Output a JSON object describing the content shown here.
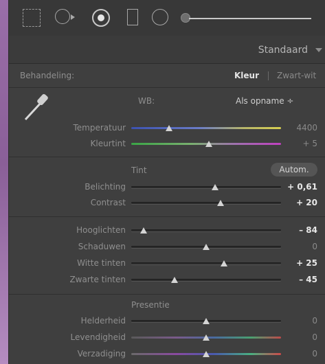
{
  "toolbar": {
    "tools": [
      "crop-overlay-icon",
      "spot-removal-icon",
      "red-eye-icon",
      "graduated-filter-icon",
      "radial-filter-icon",
      "adjustment-brush-icon"
    ]
  },
  "preset": {
    "label": "Standaard"
  },
  "treatment": {
    "label": "Behandeling:",
    "color": "Kleur",
    "bw": "Zwart-wit"
  },
  "wb": {
    "label": "WB:",
    "value": "Als opname ÷",
    "sliders": [
      {
        "label": "Temperatuur",
        "value": "4400",
        "pos": 0.25
      },
      {
        "label": "Kleurtint",
        "value": "+ 5",
        "pos": 0.52
      }
    ]
  },
  "tone": {
    "title": "Tint",
    "auto": "Autom.",
    "sliders": [
      {
        "label": "Belichting",
        "value": "+ 0,61",
        "pos": 0.56
      },
      {
        "label": "Contrast",
        "value": "+ 20",
        "pos": 0.6
      }
    ],
    "sliders2": [
      {
        "label": "Hooglichten",
        "value": "– 84",
        "pos": 0.08
      },
      {
        "label": "Schaduwen",
        "value": "0",
        "pos": 0.5
      },
      {
        "label": "Witte tinten",
        "value": "+ 25",
        "pos": 0.62
      },
      {
        "label": "Zwarte tinten",
        "value": "– 45",
        "pos": 0.29
      }
    ]
  },
  "presence": {
    "title": "Presentie",
    "sliders": [
      {
        "label": "Helderheid",
        "value": "0",
        "pos": 0.5
      },
      {
        "label": "Levendigheid",
        "value": "0",
        "pos": 0.5
      },
      {
        "label": "Verzadiging",
        "value": "0",
        "pos": 0.5
      }
    ]
  }
}
